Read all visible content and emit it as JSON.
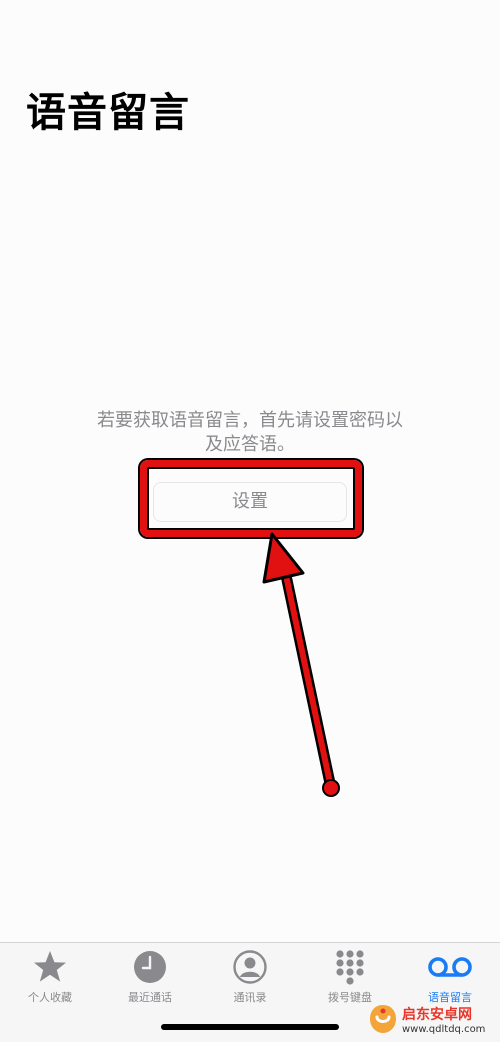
{
  "header": {
    "title": "语音留言"
  },
  "empty_state": {
    "message_line1": "若要获取语音留言，首先请设置密码以",
    "message_line2": "及应答语。",
    "setup_button": "设置"
  },
  "tab_bar": {
    "active": "voicemail",
    "items": [
      {
        "id": "favorites",
        "label": "个人收藏",
        "icon": "star-icon"
      },
      {
        "id": "recents",
        "label": "最近通话",
        "icon": "clock-icon"
      },
      {
        "id": "contacts",
        "label": "通讯录",
        "icon": "person-circle-icon"
      },
      {
        "id": "keypad",
        "label": "拨号键盘",
        "icon": "keypad-icon"
      },
      {
        "id": "voicemail",
        "label": "语音留言",
        "icon": "voicemail-icon"
      }
    ]
  },
  "watermark": {
    "name": "启东安卓网",
    "url": "www.qdltdq.com"
  },
  "colors": {
    "accent": "#1a7cf5",
    "inactive": "#8a8a8e",
    "annotation": "#e11111"
  }
}
